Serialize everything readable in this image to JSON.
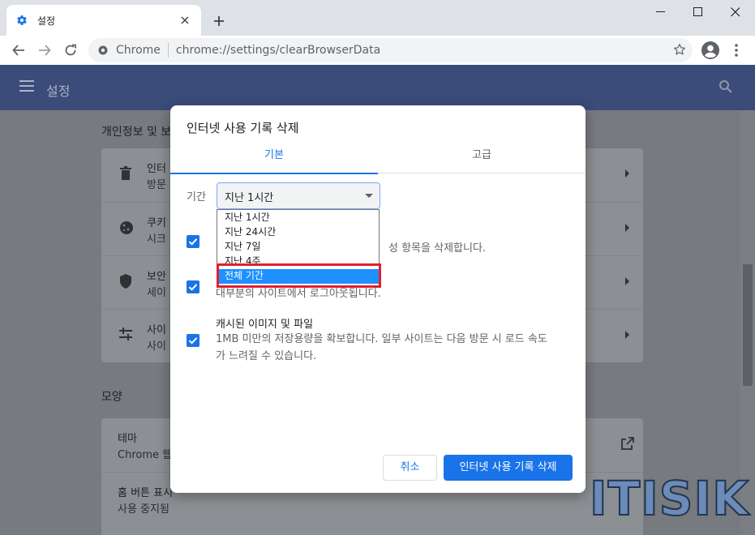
{
  "browser": {
    "tab_title": "설정",
    "omnibox_origin": "Chrome",
    "omnibox_url": "chrome://settings/clearBrowserData"
  },
  "settings": {
    "header_title": "설정",
    "section_privacy": "개인정보 및 보",
    "privacy_rows": [
      {
        "title": "인터",
        "sub": "방문"
      },
      {
        "title": "쿠키",
        "sub": "시크"
      },
      {
        "title": "보안",
        "sub": "세이"
      },
      {
        "title": "사이",
        "sub": "사이"
      }
    ],
    "section_appearance": "모양",
    "appearance_rows": [
      {
        "title": "테마",
        "sub": "Chrome 웹"
      },
      {
        "title": "홈 버튼 표시",
        "sub": "사용 중지됨"
      }
    ]
  },
  "dialog": {
    "title": "인터넷 사용 기록 삭제",
    "tabs": [
      "기본",
      "고급"
    ],
    "period_label": "기간",
    "period_value": "지난 1시간",
    "period_options": [
      "지난 1시간",
      "지난 24시간",
      "지난 7일",
      "지난 4주",
      "전체 기간"
    ],
    "item2_partial_desc": "성 항목을 삭제합니다.",
    "item3_partial_desc": "대부분의 사이트에서 로그아웃됩니다.",
    "cache_title": "캐시된 이미지 및 파일",
    "cache_desc_line1": "1MB 미만의 저장용량을 확보합니다. 일부 사이트는 다음 방문 시 로드 속도",
    "cache_desc_line2": "가 느려질 수 있습니다.",
    "cancel_label": "취소",
    "clear_label": "인터넷 사용 기록 삭제"
  },
  "watermark": "ITISIK",
  "colors": {
    "accent": "#1a73e8",
    "header": "#3b4b7a",
    "highlight": "#e0202e"
  }
}
